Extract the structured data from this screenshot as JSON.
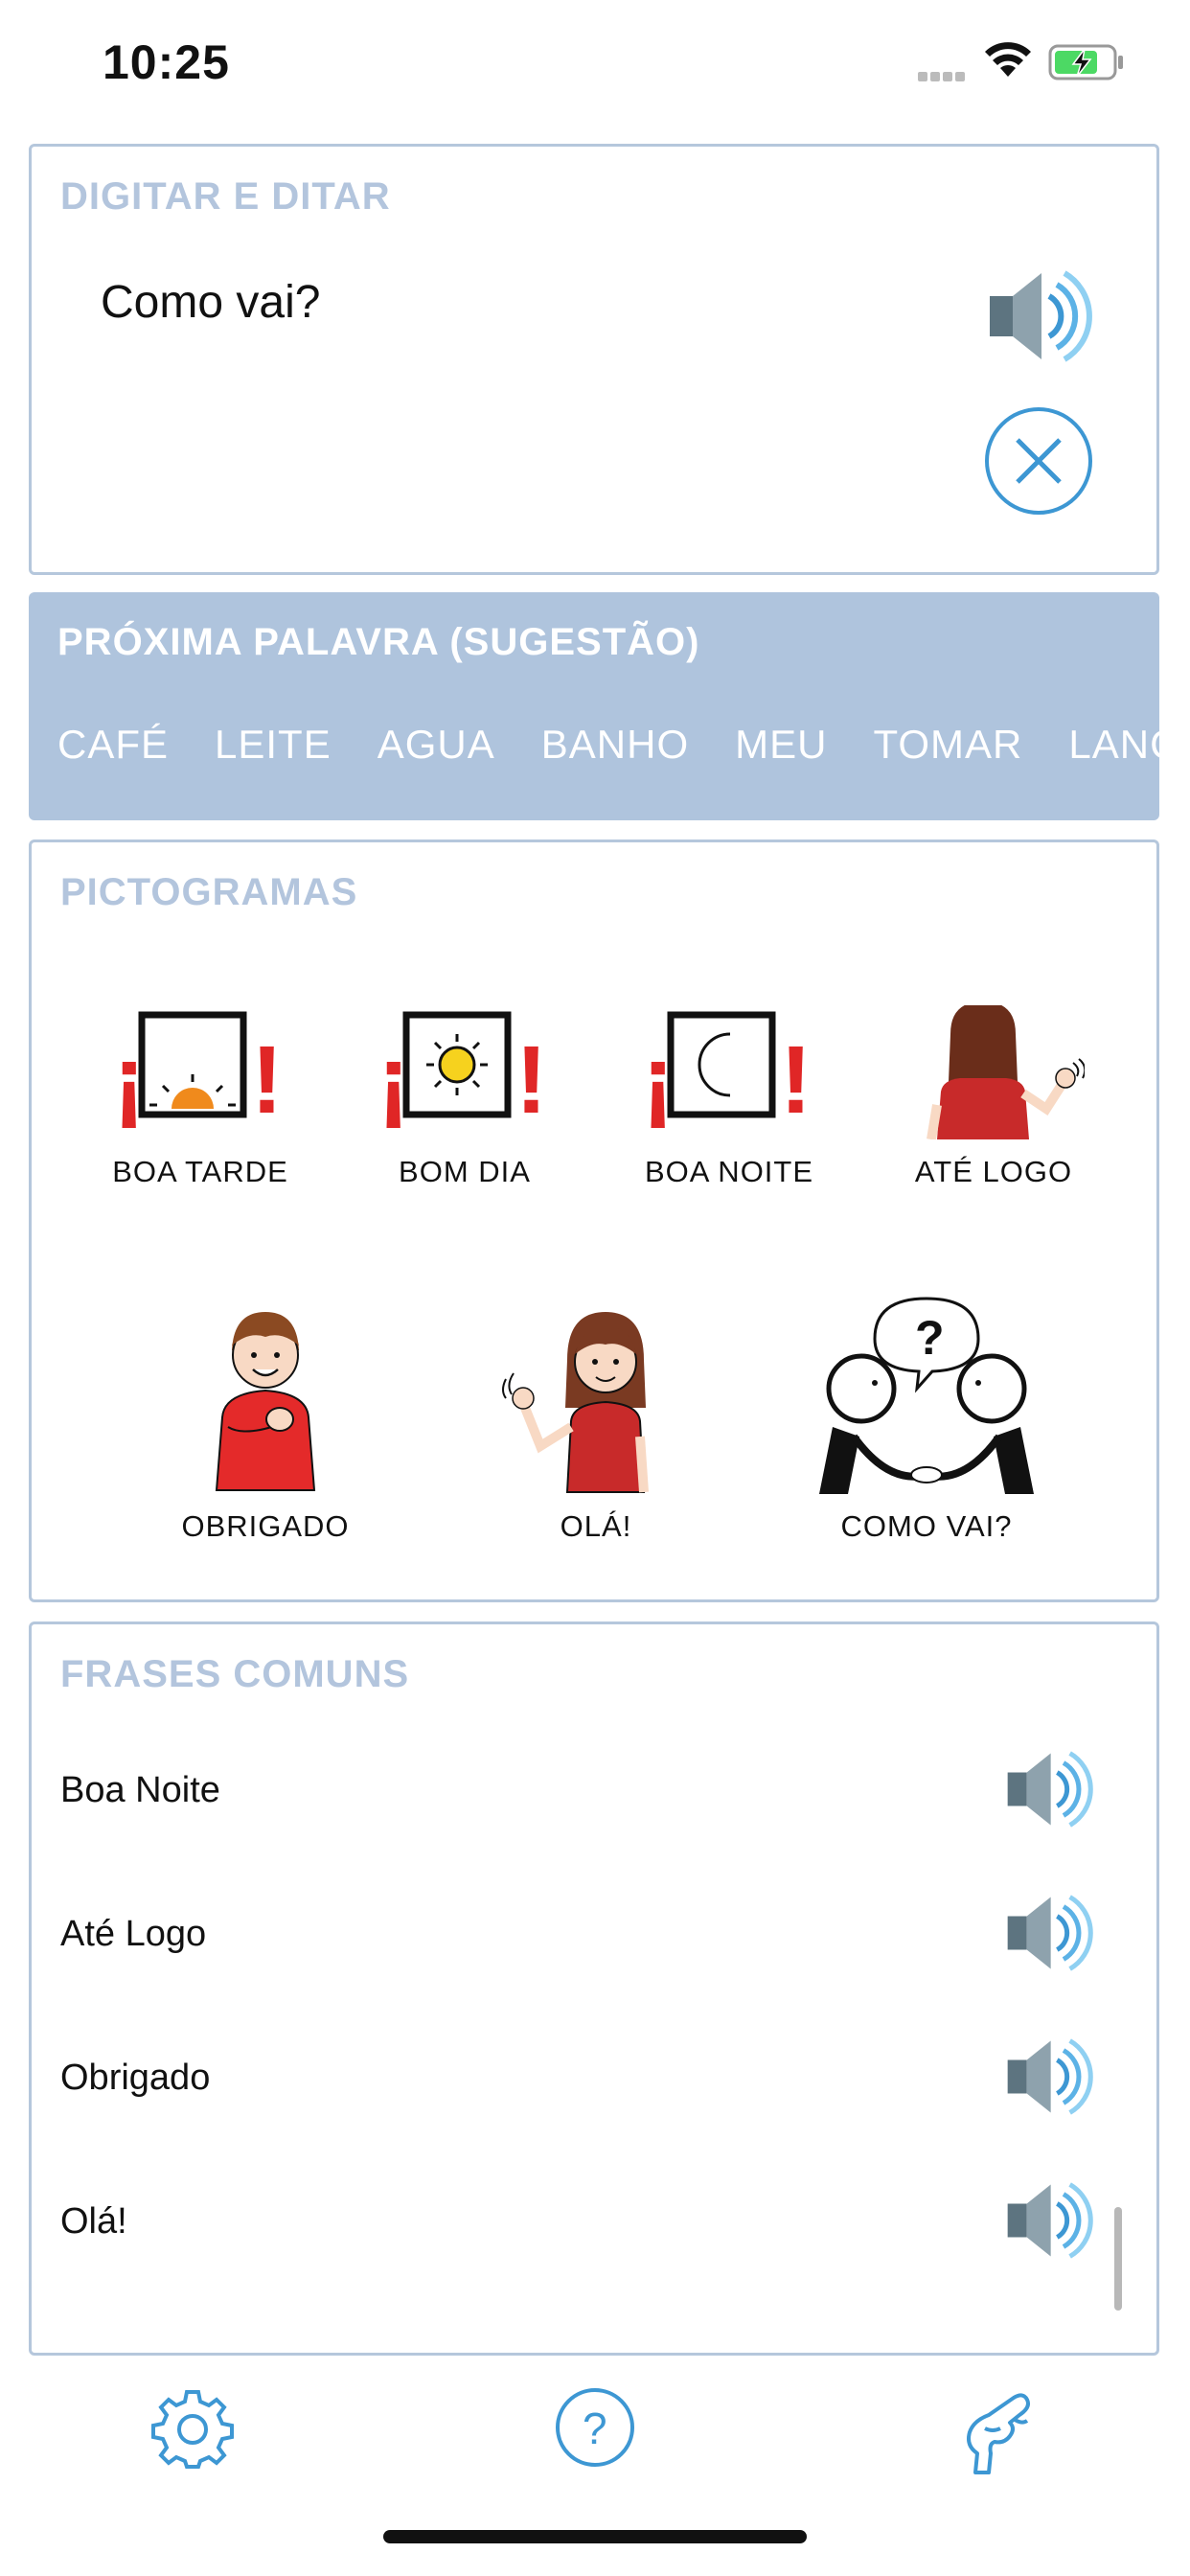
{
  "status": {
    "time": "10:25"
  },
  "dictation": {
    "title": "DIGITAR E DITAR",
    "text": "Como vai?"
  },
  "suggestions": {
    "title": "PRÓXIMA PALAVRA (SUGESTÃO)",
    "words": [
      "CAFÉ",
      "LEITE",
      "AGUA",
      "BANHO",
      "MEU",
      "TOMAR",
      "LANC"
    ]
  },
  "pictograms": {
    "title": "PICTOGRAMAS",
    "items": [
      "BOA TARDE",
      "BOM DIA",
      "BOA NOITE",
      "ATÉ LOGO",
      "OBRIGADO",
      "OLÁ!",
      "COMO VAI?"
    ]
  },
  "phrases": {
    "title": "FRASES COMUNS",
    "items": [
      "Boa Noite",
      "Até Logo",
      "Obrigado",
      "Olá!"
    ]
  },
  "tabbar": {
    "icons": [
      "gear-icon",
      "help-icon",
      "hand-icon"
    ]
  },
  "colors": {
    "accent": "#3d97d3",
    "panel_header": "#afc4dd",
    "card_border": "#b5c7dc"
  }
}
